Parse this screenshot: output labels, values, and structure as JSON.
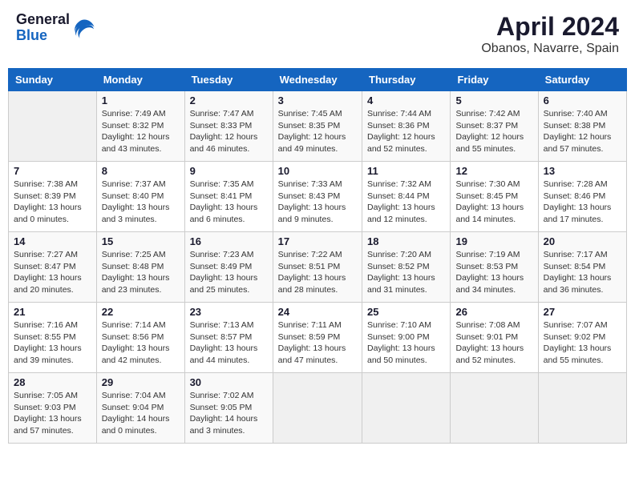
{
  "header": {
    "logo": {
      "general": "General",
      "blue": "Blue"
    },
    "title": "April 2024",
    "subtitle": "Obanos, Navarre, Spain"
  },
  "calendar": {
    "days_of_week": [
      "Sunday",
      "Monday",
      "Tuesday",
      "Wednesday",
      "Thursday",
      "Friday",
      "Saturday"
    ],
    "weeks": [
      [
        {
          "day": "",
          "info": ""
        },
        {
          "day": "1",
          "info": "Sunrise: 7:49 AM\nSunset: 8:32 PM\nDaylight: 12 hours\nand 43 minutes."
        },
        {
          "day": "2",
          "info": "Sunrise: 7:47 AM\nSunset: 8:33 PM\nDaylight: 12 hours\nand 46 minutes."
        },
        {
          "day": "3",
          "info": "Sunrise: 7:45 AM\nSunset: 8:35 PM\nDaylight: 12 hours\nand 49 minutes."
        },
        {
          "day": "4",
          "info": "Sunrise: 7:44 AM\nSunset: 8:36 PM\nDaylight: 12 hours\nand 52 minutes."
        },
        {
          "day": "5",
          "info": "Sunrise: 7:42 AM\nSunset: 8:37 PM\nDaylight: 12 hours\nand 55 minutes."
        },
        {
          "day": "6",
          "info": "Sunrise: 7:40 AM\nSunset: 8:38 PM\nDaylight: 12 hours\nand 57 minutes."
        }
      ],
      [
        {
          "day": "7",
          "info": "Sunrise: 7:38 AM\nSunset: 8:39 PM\nDaylight: 13 hours\nand 0 minutes."
        },
        {
          "day": "8",
          "info": "Sunrise: 7:37 AM\nSunset: 8:40 PM\nDaylight: 13 hours\nand 3 minutes."
        },
        {
          "day": "9",
          "info": "Sunrise: 7:35 AM\nSunset: 8:41 PM\nDaylight: 13 hours\nand 6 minutes."
        },
        {
          "day": "10",
          "info": "Sunrise: 7:33 AM\nSunset: 8:43 PM\nDaylight: 13 hours\nand 9 minutes."
        },
        {
          "day": "11",
          "info": "Sunrise: 7:32 AM\nSunset: 8:44 PM\nDaylight: 13 hours\nand 12 minutes."
        },
        {
          "day": "12",
          "info": "Sunrise: 7:30 AM\nSunset: 8:45 PM\nDaylight: 13 hours\nand 14 minutes."
        },
        {
          "day": "13",
          "info": "Sunrise: 7:28 AM\nSunset: 8:46 PM\nDaylight: 13 hours\nand 17 minutes."
        }
      ],
      [
        {
          "day": "14",
          "info": "Sunrise: 7:27 AM\nSunset: 8:47 PM\nDaylight: 13 hours\nand 20 minutes."
        },
        {
          "day": "15",
          "info": "Sunrise: 7:25 AM\nSunset: 8:48 PM\nDaylight: 13 hours\nand 23 minutes."
        },
        {
          "day": "16",
          "info": "Sunrise: 7:23 AM\nSunset: 8:49 PM\nDaylight: 13 hours\nand 25 minutes."
        },
        {
          "day": "17",
          "info": "Sunrise: 7:22 AM\nSunset: 8:51 PM\nDaylight: 13 hours\nand 28 minutes."
        },
        {
          "day": "18",
          "info": "Sunrise: 7:20 AM\nSunset: 8:52 PM\nDaylight: 13 hours\nand 31 minutes."
        },
        {
          "day": "19",
          "info": "Sunrise: 7:19 AM\nSunset: 8:53 PM\nDaylight: 13 hours\nand 34 minutes."
        },
        {
          "day": "20",
          "info": "Sunrise: 7:17 AM\nSunset: 8:54 PM\nDaylight: 13 hours\nand 36 minutes."
        }
      ],
      [
        {
          "day": "21",
          "info": "Sunrise: 7:16 AM\nSunset: 8:55 PM\nDaylight: 13 hours\nand 39 minutes."
        },
        {
          "day": "22",
          "info": "Sunrise: 7:14 AM\nSunset: 8:56 PM\nDaylight: 13 hours\nand 42 minutes."
        },
        {
          "day": "23",
          "info": "Sunrise: 7:13 AM\nSunset: 8:57 PM\nDaylight: 13 hours\nand 44 minutes."
        },
        {
          "day": "24",
          "info": "Sunrise: 7:11 AM\nSunset: 8:59 PM\nDaylight: 13 hours\nand 47 minutes."
        },
        {
          "day": "25",
          "info": "Sunrise: 7:10 AM\nSunset: 9:00 PM\nDaylight: 13 hours\nand 50 minutes."
        },
        {
          "day": "26",
          "info": "Sunrise: 7:08 AM\nSunset: 9:01 PM\nDaylight: 13 hours\nand 52 minutes."
        },
        {
          "day": "27",
          "info": "Sunrise: 7:07 AM\nSunset: 9:02 PM\nDaylight: 13 hours\nand 55 minutes."
        }
      ],
      [
        {
          "day": "28",
          "info": "Sunrise: 7:05 AM\nSunset: 9:03 PM\nDaylight: 13 hours\nand 57 minutes."
        },
        {
          "day": "29",
          "info": "Sunrise: 7:04 AM\nSunset: 9:04 PM\nDaylight: 14 hours\nand 0 minutes."
        },
        {
          "day": "30",
          "info": "Sunrise: 7:02 AM\nSunset: 9:05 PM\nDaylight: 14 hours\nand 3 minutes."
        },
        {
          "day": "",
          "info": ""
        },
        {
          "day": "",
          "info": ""
        },
        {
          "day": "",
          "info": ""
        },
        {
          "day": "",
          "info": ""
        }
      ]
    ]
  }
}
